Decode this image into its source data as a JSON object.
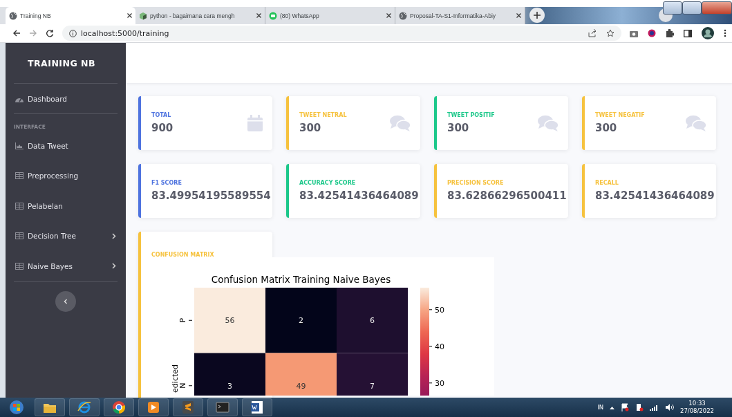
{
  "browser": {
    "tabs": [
      {
        "title": "Training NB",
        "kind": "globe",
        "selected": true
      },
      {
        "title": "python - bagaimana cara mengh",
        "kind": "cube",
        "selected": false
      },
      {
        "title": "(80) WhatsApp",
        "kind": "chat",
        "selected": false
      },
      {
        "title": "Proposal-TA-S1-Informatika-Abiy",
        "kind": "globe",
        "selected": false
      }
    ],
    "url": "localhost:5000/training"
  },
  "sidebar": {
    "brand": "TRAINING NB",
    "items": [
      {
        "label": "Dashboard",
        "kind": "gauge",
        "has_submenu": false
      },
      {
        "kind": "heading",
        "label": "INTERFACE"
      },
      {
        "label": "Data Tweet",
        "kind": "chart",
        "has_submenu": false
      },
      {
        "label": "Preprocessing",
        "kind": "table",
        "has_submenu": false
      },
      {
        "label": "Pelabelan",
        "kind": "table",
        "has_submenu": false
      },
      {
        "label": "Decision Tree",
        "kind": "table",
        "has_submenu": true
      },
      {
        "label": "Naive Bayes",
        "kind": "table",
        "has_submenu": true
      }
    ]
  },
  "stat_cards": [
    {
      "label": "TOTAL",
      "value": "900",
      "color": "#4e73df",
      "kind": "calendar"
    },
    {
      "label": "TWEET NETRAL",
      "value": "300",
      "color": "#f6c23e",
      "kind": "comments"
    },
    {
      "label": "TWEET POSITIF",
      "value": "300",
      "color": "#1cc88a",
      "kind": "comments"
    },
    {
      "label": "TWEET NEGATIF",
      "value": "300",
      "color": "#f6c23e",
      "kind": "comments"
    },
    {
      "label": "F1 SCORE",
      "value": "83.49954195589554",
      "color": "#4e73df",
      "kind": "plain"
    },
    {
      "label": "ACCURACY SCORE",
      "value": "83.42541436464089",
      "color": "#1cc88a",
      "kind": "plain"
    },
    {
      "label": "PRECISION SCORE",
      "value": "83.62866296500411",
      "color": "#f6c23e",
      "kind": "plain"
    },
    {
      "label": "RECALL",
      "value": "83.42541436464089",
      "color": "#f6c23e",
      "kind": "plain"
    }
  ],
  "confusion_card": {
    "label": "CONFUSION MATRIX",
    "color": "#f6c23e",
    "heatmap": {
      "title": "Confusion Matrix Training Naive Bayes",
      "ylabel": "edicted",
      "rows": [
        {
          "label": "P",
          "cells": [
            "56",
            "2",
            "6"
          ]
        },
        {
          "label": "N",
          "cells": [
            "3",
            "49",
            "7"
          ]
        }
      ],
      "colorbar_ticks": [
        "50",
        "40",
        "30"
      ]
    }
  },
  "taskbar": {
    "language": "IN",
    "time": "10:33",
    "date": "27/08/2022"
  }
}
